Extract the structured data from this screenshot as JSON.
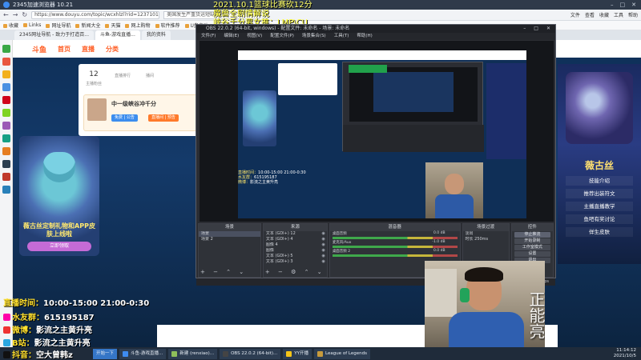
{
  "browser": {
    "title": "2345加速浏览器 10.21",
    "url": "https://www.douyu.com/topic/wcxhlzl?rid=1237101",
    "top_menu": [
      "文件",
      "查看",
      "收藏",
      "工具",
      "帮助"
    ],
    "search_text": "美国发生严重货运短缺问题"
  },
  "bookmarks": [
    "收藏",
    "Links",
    "网址导航",
    "新闻大全",
    "天猫",
    "网上购物",
    "软件推荐",
    "U盘启动"
  ],
  "tabs": [
    {
      "label": "2345网址导航 - 致力于打造百...",
      "active": false
    },
    {
      "label": "斗鱼-游戏直播...",
      "active": true
    },
    {
      "label": "我的资料",
      "active": false
    }
  ],
  "overlay_top": {
    "line1": "2021.10.1篮球比赛砍12分",
    "line2": "魔兽全剧情解说",
    "line3": "峡谷千分男女推：LMP\\CU"
  },
  "douyu": {
    "brand": "斗鱼",
    "nav": [
      "首页",
      "直播",
      "分类"
    ],
    "stats": [
      {
        "n": "12",
        "l": "主播粉丝"
      },
      {
        "n": "",
        "l": "直播排行"
      },
      {
        "n": "",
        "l": "播间"
      }
    ],
    "promo_title": "中一级峡谷冲千分",
    "promo_level": "等级",
    "promo_name": "空大防韩z",
    "promo_count": "206844",
    "promo_btns": [
      "免费 | 公告",
      "直播间 | 预告"
    ],
    "left_banner": {
      "caption": "薇古丝定制礼物和APP皮肤上线啦",
      "pill": "立即领取"
    },
    "right_banner": {
      "title": "薇古丝",
      "items": [
        "技能介绍",
        "推荐出装符文",
        "主播直播教学",
        "鱼吧有奖讨论",
        "佯生皮肤"
      ]
    }
  },
  "obs": {
    "title": "OBS 22.0.2 (64-bit, windows) - 配置文件: 未命名 - 场景: 未命名",
    "menu": [
      "文件(F)",
      "编辑(E)",
      "视图(V)",
      "配置文件(P)",
      "场景集合(S)",
      "工具(T)",
      "帮助(H)"
    ],
    "docks": {
      "scenes": {
        "title": "场景",
        "items": [
          "场景",
          "场景 2"
        ]
      },
      "sources": {
        "title": "来源",
        "items": [
          "文本 (GDI+) 12",
          "文本 (GDI+) 4",
          "图像 4",
          "图像",
          "文本 (GDI+) 5",
          "文本 (GDI+) 3"
        ]
      },
      "mixer": {
        "title": "混音器",
        "channels": [
          {
            "name": "桌面音频",
            "db": "0.0 dB"
          },
          {
            "name": "麦克风/Aux",
            "db": "-1.0 dB"
          },
          {
            "name": "桌面音频 2",
            "db": "0.0 dB"
          }
        ]
      },
      "transitions": {
        "title": "场景过渡",
        "type": "淡出",
        "duration_label": "时长",
        "duration": "250ms"
      },
      "controls": {
        "title": "控件",
        "buttons": [
          "停止推流",
          "开始录制",
          "工作室模式",
          "设置",
          "退出"
        ]
      }
    },
    "status": "LIVE: 00:00:54   REC: 00:00:00   CPU: 12.1%, 30.00 fps"
  },
  "mini_stats": {
    "time_label": "直播时间：",
    "time_value": "10:00-15:00 21:00-0:30",
    "qq_label": "水友群：",
    "qq_value": "615195187",
    "weibo_label": "微博：",
    "weibo_value": "影流之主黄升亮"
  },
  "webcam_text": "正能亮",
  "overlays": {
    "time_label": "直播时间：",
    "time_value": "10:00-15:00 21:00-0:30",
    "qq_label": "水友群：",
    "qq_value": "615195187",
    "weibo_label": "微博：",
    "weibo_value": "影流之主黄升亮",
    "extra_label": "B站：",
    "extra_value": "影流之主黄升亮",
    "douyin_label": "抖音：",
    "douyin_value": "空大曾韩z"
  },
  "taskbar": {
    "start": "开始一下",
    "items": [
      "斗鱼-游戏直播...",
      "新建 (renxiao)...",
      "OBS 22.0.2 (64-bit)...",
      "YY开播",
      "League of Legends"
    ],
    "time": "11:14:12",
    "date": "2021/10/5"
  }
}
